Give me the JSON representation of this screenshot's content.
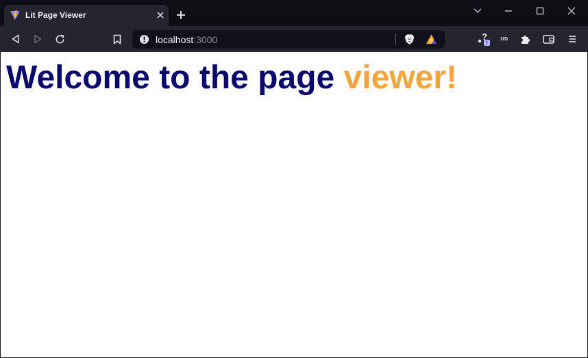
{
  "tab": {
    "title": "Lit Page Viewer"
  },
  "address_bar": {
    "host": "localhost",
    "port": ":3000"
  },
  "page": {
    "heading_prefix": "Welcome to the ",
    "heading_emphasis": "page",
    "heading_space": " ",
    "heading_accent": "viewer!"
  },
  "colors": {
    "heading_text": "#0a0a6e",
    "heading_accent": "#f2a53a",
    "page_background": "#ffffff",
    "chrome_dark": "#0e0f15",
    "toolbar": "#24252f"
  },
  "icons": {
    "favicon": "vite-logo-icon",
    "tab_close": "close-icon",
    "new_tab": "plus-icon",
    "tab_search": "chevron-down-icon",
    "minimize": "minimize-icon",
    "maximize": "maximize-icon",
    "window_close": "close-icon",
    "back": "back-icon",
    "forward": "forward-icon",
    "reload": "reload-icon",
    "bookmark": "bookmark-icon",
    "site_info": "info-icon",
    "brave_shields": "brave-lion-icon",
    "brave_rewards": "rewards-triangle-icon",
    "extension_question": "question-extension-icon",
    "extension_ud": "ud-extension-icon",
    "extensions": "puzzle-icon",
    "wallet": "wallet-icon",
    "menu": "menu-icon"
  },
  "extension_ud_label": "UD"
}
